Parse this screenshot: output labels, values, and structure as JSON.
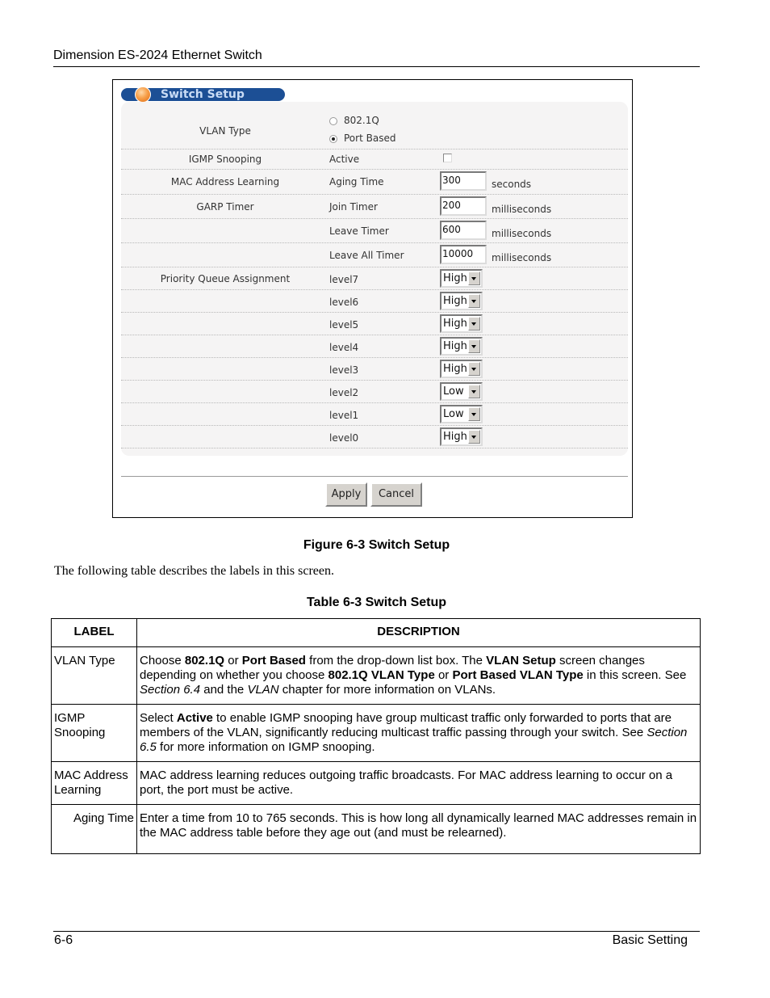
{
  "header": {
    "title": "Dimension ES-2024 Ethernet Switch"
  },
  "screen": {
    "title": "Switch Setup",
    "vlan_type": {
      "label": "VLAN Type",
      "options": [
        {
          "label": "802.1Q",
          "selected": false
        },
        {
          "label": "Port Based",
          "selected": true
        }
      ]
    },
    "igmp": {
      "label": "IGMP Snooping",
      "field": "Active",
      "checked": false
    },
    "mac": {
      "label": "MAC Address Learning",
      "field": "Aging Time",
      "value": "300",
      "unit": "seconds"
    },
    "garp": {
      "label": "GARP Timer",
      "rows": [
        {
          "field": "Join Timer",
          "value": "200",
          "unit": "milliseconds"
        },
        {
          "field": "Leave Timer",
          "value": "600",
          "unit": "milliseconds"
        },
        {
          "field": "Leave All Timer",
          "value": "10000",
          "unit": "milliseconds"
        }
      ]
    },
    "priority": {
      "label": "Priority Queue Assignment",
      "levels": [
        {
          "name": "level7",
          "value": "High"
        },
        {
          "name": "level6",
          "value": "High"
        },
        {
          "name": "level5",
          "value": "High"
        },
        {
          "name": "level4",
          "value": "High"
        },
        {
          "name": "level3",
          "value": "High"
        },
        {
          "name": "level2",
          "value": "Low"
        },
        {
          "name": "level1",
          "value": "Low"
        },
        {
          "name": "level0",
          "value": "High"
        }
      ]
    },
    "buttons": {
      "apply": "Apply",
      "cancel": "Cancel"
    }
  },
  "figure_caption": "Figure 6-3 Switch Setup",
  "intro_text": "The following table describes the labels in this screen.",
  "table": {
    "caption": "Table 6-3 Switch Setup",
    "headers": [
      "LABEL",
      "DESCRIPTION"
    ],
    "rows": [
      {
        "label": "VLAN Type",
        "description_parts": [
          {
            "t": "Choose ",
            "s": "n"
          },
          {
            "t": "802.1Q",
            "s": "b"
          },
          {
            "t": " or ",
            "s": "n"
          },
          {
            "t": "Port Based",
            "s": "b"
          },
          {
            "t": " from the drop-down list box. The ",
            "s": "n"
          },
          {
            "t": "VLAN Setup",
            "s": "b"
          },
          {
            "t": " screen changes depending on whether you choose ",
            "s": "n"
          },
          {
            "t": "802.1Q VLAN Type",
            "s": "b"
          },
          {
            "t": " or ",
            "s": "n"
          },
          {
            "t": "Port Based VLAN Type",
            "s": "b"
          },
          {
            "t": " in this screen. See ",
            "s": "n"
          },
          {
            "t": "Section 6.4",
            "s": "i"
          },
          {
            "t": " and the ",
            "s": "n"
          },
          {
            "t": "VLAN",
            "s": "i"
          },
          {
            "t": " chapter for more information on VLANs.",
            "s": "n"
          }
        ]
      },
      {
        "label": "IGMP Snooping",
        "description_parts": [
          {
            "t": "Select ",
            "s": "n"
          },
          {
            "t": "Active",
            "s": "b"
          },
          {
            "t": " to enable IGMP snooping have group multicast traffic only forwarded to ports that are members of the VLAN, significantly reducing multicast traffic passing through your switch. See ",
            "s": "n"
          },
          {
            "t": "Section 6.5",
            "s": "i"
          },
          {
            "t": " for more information on IGMP snooping.",
            "s": "n"
          }
        ]
      },
      {
        "label": "MAC Address Learning",
        "description_parts": [
          {
            "t": "MAC address learning reduces outgoing traffic broadcasts. For MAC address learning to occur on a port, the port must be active.",
            "s": "n"
          }
        ]
      },
      {
        "label": "Aging Time",
        "indent": true,
        "description_parts": [
          {
            "t": "Enter a time from 10 to 765 seconds. This is how long all dynamically learned MAC addresses remain in the MAC address table before they age out (and must be relearned).",
            "s": "n"
          }
        ]
      }
    ]
  },
  "footer": {
    "page": "6-6",
    "section": "Basic Setting"
  }
}
